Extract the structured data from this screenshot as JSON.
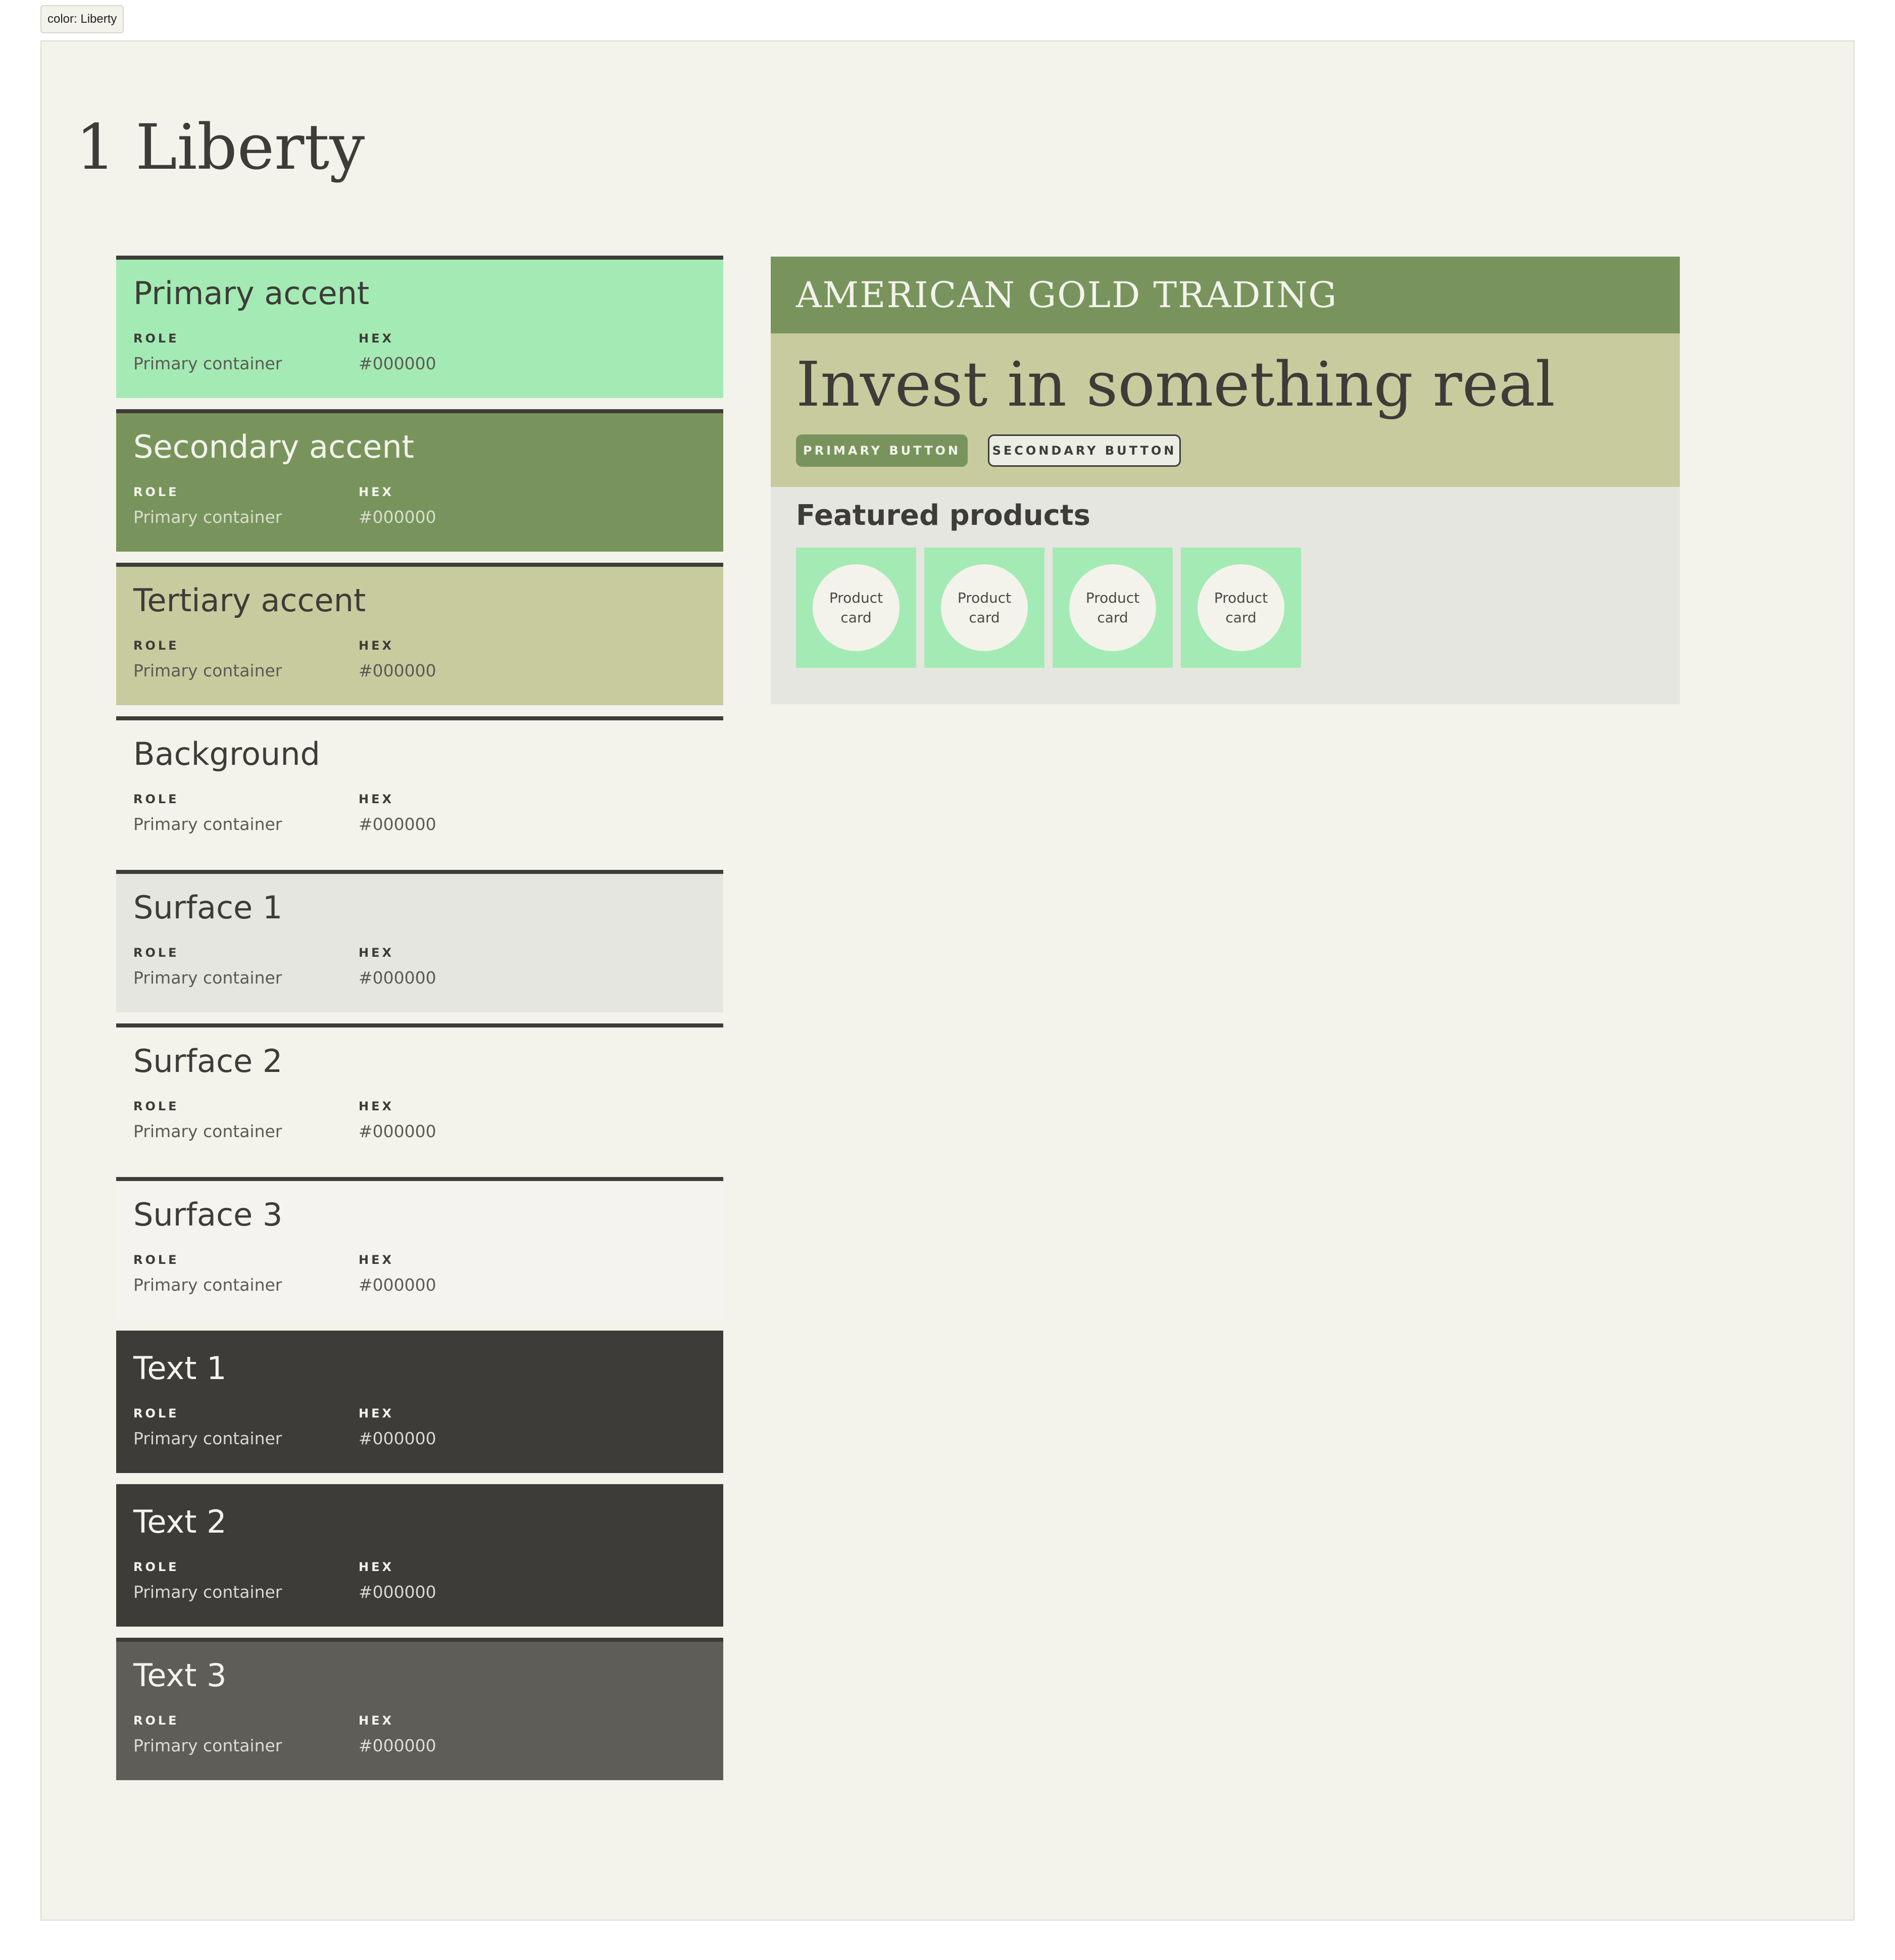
{
  "tag": "color: Liberty",
  "page_title": "1 Liberty",
  "labels": {
    "role": "ROLE",
    "hex": "HEX"
  },
  "swatches": [
    {
      "name": "Primary accent",
      "role": "Primary container",
      "hex": "#000000",
      "bg": "#a4eab4",
      "fg": "#3d3c38",
      "sub": "#5b5a55"
    },
    {
      "name": "Secondary accent",
      "role": "Primary container",
      "hex": "#000000",
      "bg": "#78945c",
      "fg": "#f3f3ec",
      "sub": "#d9decf"
    },
    {
      "name": "Tertiary accent",
      "role": "Primary container",
      "hex": "#000000",
      "bg": "#c8cb9e",
      "fg": "#3d3c38",
      "sub": "#5b5a55"
    },
    {
      "name": "Background",
      "role": "Primary container",
      "hex": "#000000",
      "bg": "#f3f3ec",
      "fg": "#3d3c38",
      "sub": "#5b5a55"
    },
    {
      "name": "Surface 1",
      "role": "Primary container",
      "hex": "#000000",
      "bg": "#e6e6e0",
      "fg": "#3d3c38",
      "sub": "#5b5a55"
    },
    {
      "name": "Surface 2",
      "role": "Primary container",
      "hex": "#000000",
      "bg": "#f3f3ec",
      "fg": "#3d3c38",
      "sub": "#5b5a55"
    },
    {
      "name": "Surface 3",
      "role": "Primary container",
      "hex": "#000000",
      "bg": "#f4f3ef",
      "fg": "#3d3c38",
      "sub": "#5b5a55"
    },
    {
      "name": "Text 1",
      "role": "Primary container",
      "hex": "#000000",
      "bg": "#3d3c38",
      "fg": "#f3f3ec",
      "sub": "#d8d8d2"
    },
    {
      "name": "Text 2",
      "role": "Primary container",
      "hex": "#000000",
      "bg": "#3d3c38",
      "fg": "#f3f3ec",
      "sub": "#d8d8d2"
    },
    {
      "name": "Text 3",
      "role": "Primary container",
      "hex": "#000000",
      "bg": "#5e5d58",
      "fg": "#f3f3ec",
      "sub": "#dcdcd6"
    }
  ],
  "preview": {
    "brand": "AMERICAN GOLD TRADING",
    "headline": "Invest in something real",
    "primary_button": "PRIMARY BUTTON",
    "secondary_button": "SECONDARY BUTTON",
    "featured_title": "Featured products",
    "cards": [
      "Product card",
      "Product card",
      "Product card",
      "Product card"
    ]
  }
}
